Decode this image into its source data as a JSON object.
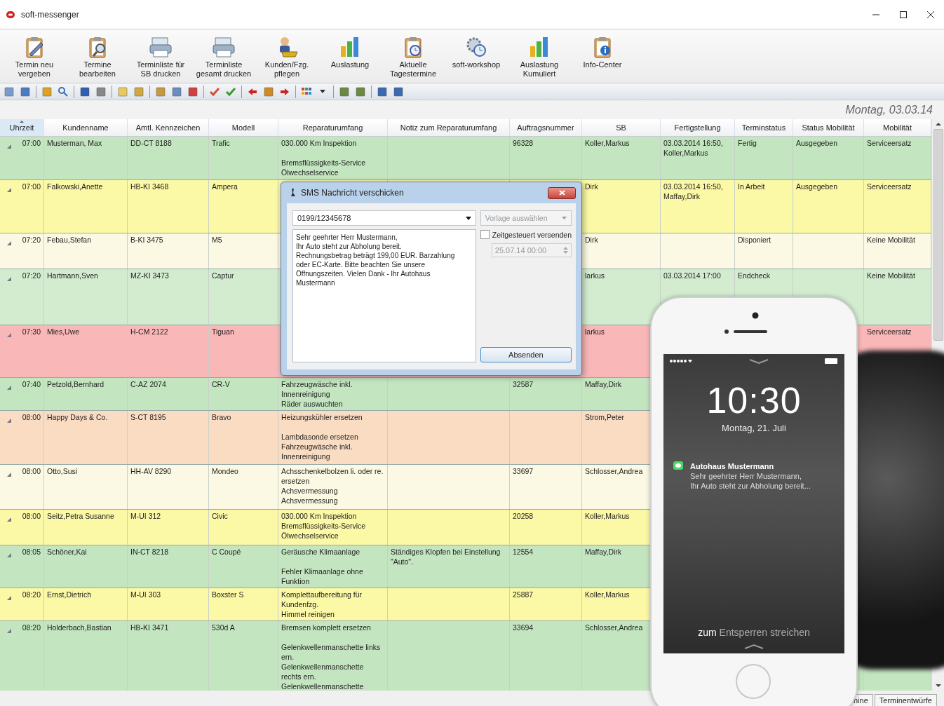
{
  "window": {
    "title": "soft-messenger"
  },
  "ribbon": [
    {
      "label": "Termin neu\nvergeben"
    },
    {
      "label": "Termine\nbearbeiten"
    },
    {
      "label": "Terminliste für\nSB drucken"
    },
    {
      "label": "Terminliste\ngesamt drucken"
    },
    {
      "label": "Kunden/Fzg.\npflegen"
    },
    {
      "label": "Auslastung"
    },
    {
      "label": "Aktuelle\nTagestermine"
    },
    {
      "label": "soft-workshop"
    },
    {
      "label": "Auslastung\nKumuliert"
    },
    {
      "label": "Info-Center"
    }
  ],
  "date": "Montag, 03.03.14",
  "table": {
    "columns": [
      {
        "label": "Uhrzeit",
        "sorted": true
      },
      {
        "label": "Kundenname",
        "sorted": false
      },
      {
        "label": "Amtl. Kennzeichen",
        "sorted": false
      },
      {
        "label": "Modell",
        "sorted": false
      },
      {
        "label": "Reparaturumfang",
        "sorted": false
      },
      {
        "label": "Notiz zum Reparaturumfang",
        "sorted": false
      },
      {
        "label": "Auftragsnummer",
        "sorted": false
      },
      {
        "label": "SB",
        "sorted": false
      },
      {
        "label": "Fertigstellung",
        "sorted": false
      },
      {
        "label": "Terminstatus",
        "sorted": false
      },
      {
        "label": "Status Mobilität",
        "sorted": false
      },
      {
        "label": "Mobilität",
        "sorted": false
      }
    ],
    "rows": [
      {
        "color": "#c3e5bf",
        "time": "07:00",
        "customer": "Musterman, Max",
        "plate": "DD-CT 8188",
        "model": "Trafic",
        "repair": "030.000 Km Inspektion\n\nBremsflüssigkeits-Service\nÖlwechselservice",
        "order": "96328",
        "advisor": "Koller,Markus",
        "completion": "03.03.2014 16:50,\nKoller,Markus",
        "status": "Fertig",
        "mobility_status": "Ausgegeben",
        "mobility": "Serviceersatz"
      },
      {
        "color": "#fbf8a6",
        "time": "07:00",
        "customer": "Falkowski,Anette",
        "plate": "HB-KI 3468",
        "model": "Ampera",
        "advisor": "Dirk",
        "completion": "03.03.2014 16:50,\nMaffay,Dirk",
        "status": "In Arbeit",
        "mobility_status": "Ausgegeben",
        "mobility": "Serviceersatz"
      },
      {
        "color": "#fbf9e3",
        "time": "07:20",
        "customer": "Febau,Stefan",
        "plate": "B-KI 3475",
        "model": "M5",
        "advisor": "Dirk",
        "status": "Disponiert",
        "mobility": "Keine Mobilität"
      },
      {
        "color": "#d3ecd0",
        "time": "07:20",
        "customer": "Hartmann,Sven",
        "plate": "MZ-KI 3473",
        "model": "Captur",
        "advisor": "larkus",
        "completion": "03.03.2014 17:00",
        "status": "Endcheck",
        "mobility": "Keine Mobilität"
      },
      {
        "color": "#f9b7b7",
        "time": "07:30",
        "customer": "Mies,Uwe",
        "plate": "H-CM 2122",
        "model": "Tiguan",
        "advisor": "larkus",
        "mobility": "Serviceersatz"
      },
      {
        "color": "#c3e5bf",
        "time": "07:40",
        "customer": "Petzold,Bernhard",
        "plate": "C-AZ 2074",
        "model": "CR-V",
        "repair": "Fahrzeugwäsche inkl.\nInnenreinigung\nRäder auswuchten",
        "order": "32587",
        "advisor": "Maffay,Dirk"
      },
      {
        "color": "#fadcc3",
        "time": "08:00",
        "customer": "Happy Days & Co.",
        "plate": "S-CT 8195",
        "model": "Bravo",
        "repair": "Heizungskühler ersetzen\n\nLambdasonde ersetzen\nFahrzeugwäsche inkl.\nInnenreinigung",
        "advisor": "Strom,Peter"
      },
      {
        "color": "#fbf9e3",
        "time": "08:00",
        "customer": "Otto,Susi",
        "plate": "HH-AV 8290",
        "model": "Mondeo",
        "repair": "Achsschenkelbolzen li. oder re. ersetzen\nAchsvermessung\nAchsvermessung",
        "order": "33697",
        "advisor": "Schlosser,Andrea"
      },
      {
        "color": "#fbf8a6",
        "time": "08:00",
        "customer": "Seitz,Petra Susanne",
        "plate": "M-UI 312",
        "model": "Civic",
        "repair": "030.000 Km Inspektion\nBremsflüssigkeits-Service\nÖlwechselservice",
        "order": "20258",
        "advisor": "Koller,Markus"
      },
      {
        "color": "#c3e5bf",
        "time": "08:05",
        "customer": "Schöner,Kai",
        "plate": "IN-CT 8218",
        "model": "C Coupé",
        "repair": "Geräusche Klimaanlage\n\nFehler Klimaanlage ohne Funktion",
        "note": "Ständiges Klopfen bei Einstellung \"Auto\".",
        "order": "12554",
        "advisor": "Maffay,Dirk"
      },
      {
        "color": "#fbf8a6",
        "time": "08:20",
        "customer": "Ernst,Dietrich",
        "plate": "M-UI 303",
        "model": "Boxster S",
        "repair": "Komplettaufbereitung für Kundenfzg.\nHimmel reinigen",
        "order": "25887",
        "advisor": "Koller,Markus"
      },
      {
        "color": "#c3e5bf",
        "time": "08:20",
        "customer": "Holderbach,Bastian",
        "plate": "HB-KI 3471",
        "model": "530d A",
        "repair": "Bremsen komplett ersetzen\n\nGelenkwellenmanschette links ern.\nGelenkwellenmanschette rechts ern.\nGelenkwellenmanschette",
        "order": "33694",
        "advisor": "Schlosser,Andrea"
      }
    ]
  },
  "bottom_tabs": [
    {
      "label": "nine",
      "selected": false
    },
    {
      "label": "Terminentwürfe",
      "selected": false
    }
  ],
  "dialog": {
    "title": "SMS Nachricht verschicken",
    "recipient": "0199/12345678",
    "template": {
      "placeholder": "Vorlage auswählen",
      "disabled": true
    },
    "message": "Sehr geehrter Herr Mustermann,\nIhr Auto steht zur Abholung bereit.\nRechnungsbetrag beträgt 199,00 EUR. Barzahlung\noder EC-Karte. Bitte beachten Sie unsere\nÖffnungszeiten. Vielen Dank - Ihr Autohaus\nMustermann",
    "schedule": {
      "label": "Zeitgesteuert versenden",
      "checked": false
    },
    "datetime": {
      "value": "25.07.14 00:00",
      "disabled": true
    },
    "send_button": "Absenden"
  },
  "phone": {
    "time": "10:30",
    "date": "Montag, 21. Juli",
    "notification": {
      "sender": "Autohaus Mustermann",
      "line_1": "Sehr geehrter Herr Mustermann,",
      "line_2": "Ihr Auto steht zur Abholung bereit..."
    },
    "unlock_hint": "**zum** Entsperren streichen"
  }
}
